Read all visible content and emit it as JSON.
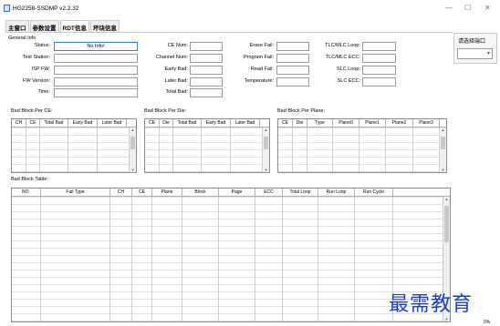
{
  "window": {
    "title": "HG2258-SSDMP v2.2.32",
    "minimize": "—",
    "maximize": "☐",
    "close": "✕"
  },
  "tabs": [
    "主窗口",
    "参数设置",
    "RDT信息",
    "坏块信息"
  ],
  "active_tab": "RDT信息",
  "general_info": {
    "title": "General Info",
    "col1": [
      {
        "label": "Status:",
        "value": "No Info!"
      },
      {
        "label": "Test Station:",
        "value": ""
      },
      {
        "label": "ISP FW:",
        "value": ""
      },
      {
        "label": "FW Version:",
        "value": ""
      },
      {
        "label": "Time:",
        "value": ""
      }
    ],
    "col2": [
      {
        "label": "CE Num:",
        "value": ""
      },
      {
        "label": "Channel Num:",
        "value": ""
      },
      {
        "label": "Early Bad:",
        "value": ""
      },
      {
        "label": "Later Bad:",
        "value": ""
      },
      {
        "label": "Total Bad:",
        "value": ""
      }
    ],
    "col3": [
      {
        "label": "Erase Fail:",
        "value": ""
      },
      {
        "label": "Program Fail:",
        "value": ""
      },
      {
        "label": "Read Fail:",
        "value": ""
      },
      {
        "label": "Temperature:",
        "value": ""
      }
    ],
    "col4": [
      {
        "label": "TLC/MLC Loop:",
        "value": ""
      },
      {
        "label": "TLC/MLC ECC:",
        "value": ""
      },
      {
        "label": "SLC Loop:",
        "value": ""
      },
      {
        "label": "SLC ECC:",
        "value": ""
      }
    ]
  },
  "port_panel": {
    "title": "请选择端口",
    "selected": ""
  },
  "bad_block_per_ce": {
    "title": "Bad Block Per CE:",
    "columns": [
      "CH",
      "CE",
      "Total Bad",
      "Early Bad",
      "Later Bad"
    ]
  },
  "bad_block_per_die": {
    "title": "Bad Block Per Die:",
    "columns": [
      "CE",
      "Die",
      "Total Bad",
      "Early Bad",
      "Later Bad"
    ]
  },
  "bad_block_per_plane": {
    "title": "Bad Block Per Plane:",
    "columns": [
      "CE",
      "Die",
      "Type",
      "Plane0",
      "Plane1",
      "Plane2",
      "Plane3"
    ]
  },
  "bad_block_table": {
    "title": "Bad Block Table:",
    "columns": [
      "NO.",
      "Fail Type",
      "CH",
      "CE",
      "Plane",
      "Block",
      "Page",
      "ECC",
      "Total Loop",
      "Run Loop",
      "Run Cycle"
    ]
  },
  "watermark": "最需教育",
  "footer_text": "0%"
}
